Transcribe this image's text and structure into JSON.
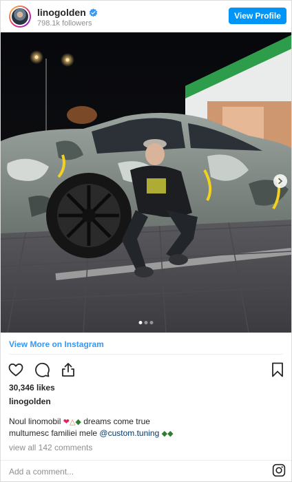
{
  "header": {
    "username": "linogolden",
    "followers": "798.1k followers",
    "view_profile_label": "View Profile"
  },
  "carousel": {
    "slide_count": 3,
    "active_slide": 1
  },
  "view_more_label": "View More on Instagram",
  "likes": "30,346 likes",
  "caption": {
    "username": "linogolden",
    "line1_text": "Noul linomobil",
    "line1_suffix": "dreams come true",
    "line2_text": "multumesc familiei mele",
    "mention": "@custom.tuning"
  },
  "comments_link": "view all 142 comments",
  "add_comment_placeholder": "Add a comment...",
  "icons": {
    "header": [
      "avatar",
      "verified-badge-icon"
    ],
    "actions": [
      "heart-icon",
      "comment-icon",
      "share-icon",
      "bookmark-icon"
    ],
    "footer": [
      "instagram-logo-icon"
    ]
  },
  "colors": {
    "accent": "#0095f6",
    "link": "#3897f0",
    "mention": "#00376b",
    "muted": "#8e8e8e"
  }
}
